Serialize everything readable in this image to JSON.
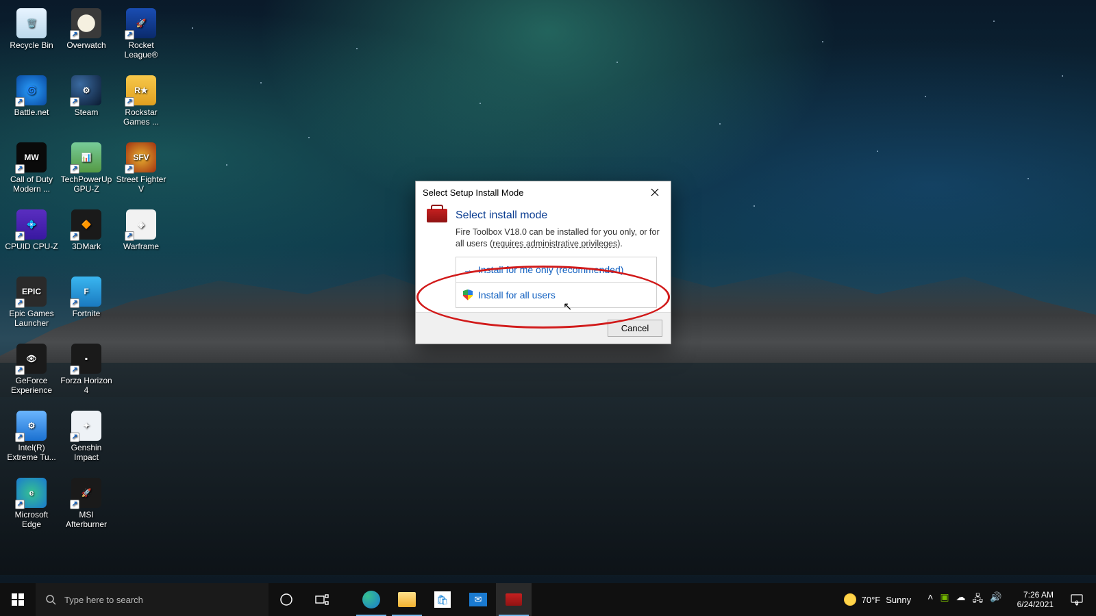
{
  "desktop_icons": [
    [
      {
        "label": "Recycle Bin",
        "name": "recycle-bin",
        "bg": "linear-gradient(#e8f4ff,#bcd9ec)",
        "emoji": "🗑️"
      },
      {
        "label": "Overwatch",
        "name": "overwatch",
        "bg": "radial-gradient(circle,#f5f0e0 40%,#3a3a3a 42%)",
        "emoji": ""
      },
      {
        "label": "Rocket League®",
        "name": "rocket-league",
        "bg": "linear-gradient(#1a4db3,#0a2a6b)",
        "emoji": "🚀"
      }
    ],
    [
      {
        "label": "Battle.net",
        "name": "battle-net",
        "bg": "radial-gradient(circle,#2aa0ff,#0a4aa0)",
        "emoji": "🌀"
      },
      {
        "label": "Steam",
        "name": "steam",
        "bg": "radial-gradient(circle at 30% 30%,#3a6aa0,#0a1a30)",
        "emoji": "⚙"
      },
      {
        "label": "Rockstar Games ...",
        "name": "rockstar-games",
        "bg": "linear-gradient(#f7c84a,#e0a020)",
        "emoji": "R★"
      }
    ],
    [
      {
        "label": "Call of Duty Modern ...",
        "name": "cod-mw",
        "bg": "#0a0a0a",
        "emoji": "MW"
      },
      {
        "label": "TechPowerUp GPU-Z",
        "name": "gpu-z",
        "bg": "linear-gradient(#7c9, #594)",
        "emoji": "📊"
      },
      {
        "label": "Street Fighter V",
        "name": "street-fighter-v",
        "bg": "radial-gradient(circle,#e8b030,#a03010)",
        "emoji": "SFV"
      }
    ],
    [
      {
        "label": "CPUID CPU-Z",
        "name": "cpu-z",
        "bg": "linear-gradient(#5a2ec0,#3818a0)",
        "emoji": "💠"
      },
      {
        "label": "3DMark",
        "name": "3dmark",
        "bg": "#1a1a1a",
        "emoji": "🔶"
      },
      {
        "label": "Warframe",
        "name": "warframe",
        "bg": "#f2f2f2",
        "emoji": "◈"
      }
    ],
    [
      {
        "label": "Epic Games Launcher",
        "name": "epic-games",
        "bg": "#2a2a2a",
        "emoji": "EPIC"
      },
      {
        "label": "Fortnite",
        "name": "fortnite",
        "bg": "linear-gradient(#3ab6f0,#1a7ac0)",
        "emoji": "F"
      },
      null
    ],
    [
      {
        "label": "GeForce Experience",
        "name": "geforce-experience",
        "bg": "#1a1a1a",
        "emoji": "👁"
      },
      {
        "label": "Forza Horizon 4",
        "name": "forza-horizon-4",
        "bg": "#1a1a1a",
        "emoji": "▪"
      },
      null
    ],
    [
      {
        "label": "Intel(R) Extreme Tu...",
        "name": "intel-xtu",
        "bg": "linear-gradient(#6bb6ff,#1a70d0)",
        "emoji": "⚙"
      },
      {
        "label": "Genshin Impact",
        "name": "genshin-impact",
        "bg": "#eef2f6",
        "emoji": "✦"
      },
      null
    ],
    [
      {
        "label": "Microsoft Edge",
        "name": "microsoft-edge",
        "bg": "radial-gradient(circle,#36c190,#1a7ad0)",
        "emoji": "e"
      },
      {
        "label": "MSI Afterburner",
        "name": "msi-afterburner",
        "bg": "#1a1a1a",
        "emoji": "🚀"
      },
      null
    ]
  ],
  "dialog": {
    "title": "Select Setup Install Mode",
    "heading": "Select install mode",
    "description_pre": "Fire Toolbox V18.0 can be installed for you only, or for all users (",
    "description_link": "requires administrative privileges",
    "description_post": ").",
    "option_me": "Install for me only (recommended)",
    "option_all": "Install for all users",
    "cancel": "Cancel"
  },
  "taskbar": {
    "search_placeholder": "Type here to search",
    "weather_temp": "70°F",
    "weather_cond": "Sunny",
    "time": "7:26 AM",
    "date": "6/24/2021",
    "notifications": "8"
  }
}
